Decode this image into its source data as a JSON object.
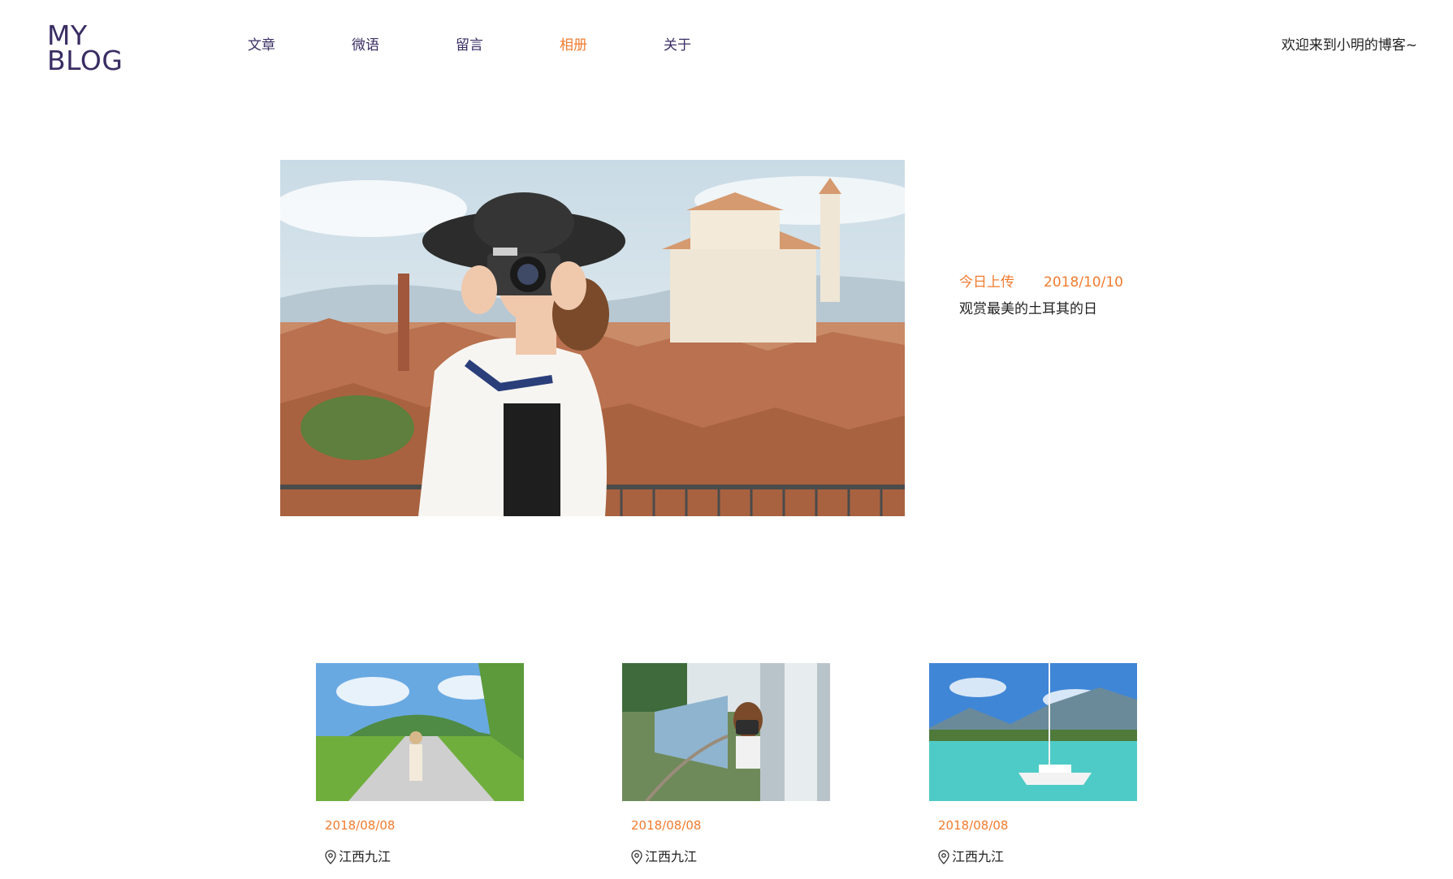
{
  "header": {
    "logo_line1": "MY",
    "logo_line2": "BLOG",
    "nav": [
      {
        "label": "文章",
        "active": false
      },
      {
        "label": "微语",
        "active": false
      },
      {
        "label": "留言",
        "active": false
      },
      {
        "label": "相册",
        "active": true
      },
      {
        "label": "关于",
        "active": false
      }
    ],
    "welcome": "欢迎来到小明的博客~"
  },
  "hero": {
    "tag": "今日上传",
    "date": "2018/10/10",
    "caption": "观赏最美的土耳其的日"
  },
  "cards": [
    {
      "date": "2018/08/08",
      "location": "江西九江",
      "icon": "location-pin-icon"
    },
    {
      "date": "2018/08/08",
      "location": "江西九江",
      "icon": "location-pin-icon"
    },
    {
      "date": "2018/08/08",
      "location": "江西九江",
      "icon": "location-pin-icon"
    }
  ],
  "colors": {
    "brand": "#3a2d63",
    "accent": "#f07b2f",
    "text": "#222222",
    "background": "#ffffff"
  }
}
